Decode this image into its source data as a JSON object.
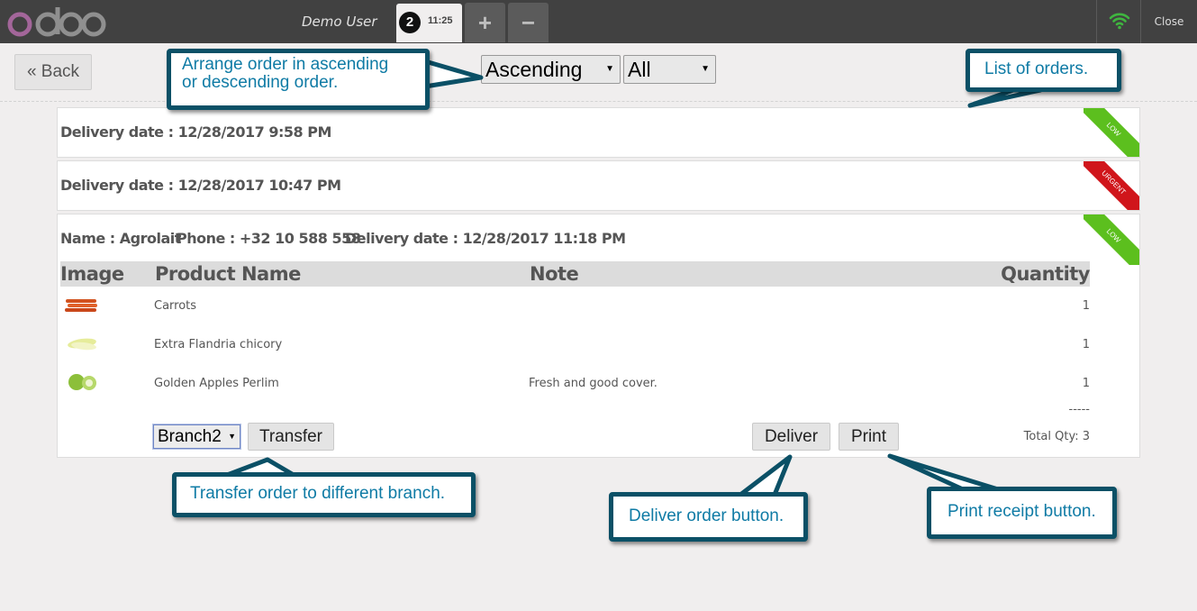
{
  "topbar": {
    "user_name": "Demo User",
    "order_number": "2",
    "order_time": "11:25",
    "add_label": "+",
    "remove_label": "−",
    "close_label": "Close"
  },
  "controls": {
    "back_label": "« Back",
    "sort_value": "Ascending",
    "filter_value": "All"
  },
  "orders": [
    {
      "delivery": "Delivery date : 12/28/2017 9:58 PM",
      "priority": "LOW"
    },
    {
      "delivery": "Delivery date : 12/28/2017 10:47 PM",
      "priority": "URGENT"
    },
    {
      "name": "Name : Agrolait",
      "phone": "Phone : +32 10 588 558",
      "delivery": "Delivery date : 12/28/2017 11:18 PM",
      "priority": "LOW",
      "headers": {
        "image": "Image",
        "product": "Product Name",
        "note": "Note",
        "quantity": "Quantity"
      },
      "lines": [
        {
          "product": "Carrots",
          "note": "",
          "qty": "1"
        },
        {
          "product": "Extra Flandria chicory",
          "note": "",
          "qty": "1"
        },
        {
          "product": "Golden Apples Perlim",
          "note": "Fresh and good cover.",
          "qty": "1"
        }
      ],
      "separator": "-----",
      "branch_value": "Branch2",
      "transfer_label": "Transfer",
      "deliver_label": "Deliver",
      "print_label": "Print",
      "total": "Total Qty: 3"
    }
  ],
  "callouts": {
    "arrange_line1": "Arrange order in ascending",
    "arrange_line2": "or descending order.",
    "list": "List of orders.",
    "transfer": "Transfer order to different branch.",
    "deliver": "Deliver order button.",
    "print": "Print receipt button."
  },
  "colors": {
    "topbar": "#414141",
    "low_ribbon": "#5cbf1e",
    "urgent_ribbon": "#d0151b",
    "callout_border": "#0b5066",
    "callout_text": "#0f7ba5",
    "wifi": "#3fb53f",
    "logo": "#a3669a"
  }
}
